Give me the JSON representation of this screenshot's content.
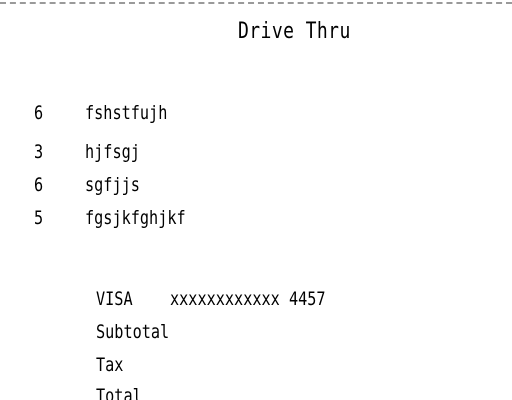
{
  "header": {
    "title": "Drive Thru"
  },
  "items": [
    {
      "qty": "6",
      "name": "fshstfujh"
    },
    {
      "qty": "3",
      "name": "hjfsgj"
    },
    {
      "qty": "6",
      "name": "sgfjjs"
    },
    {
      "qty": "5",
      "name": "fgsjkfghjkf"
    }
  ],
  "payment": {
    "card_type": "VISA",
    "card_number": "xxxxxxxxxxxx 4457"
  },
  "summary": {
    "subtotal_label": "Subtotal",
    "tax_label": "Tax",
    "total_label": "Total"
  }
}
